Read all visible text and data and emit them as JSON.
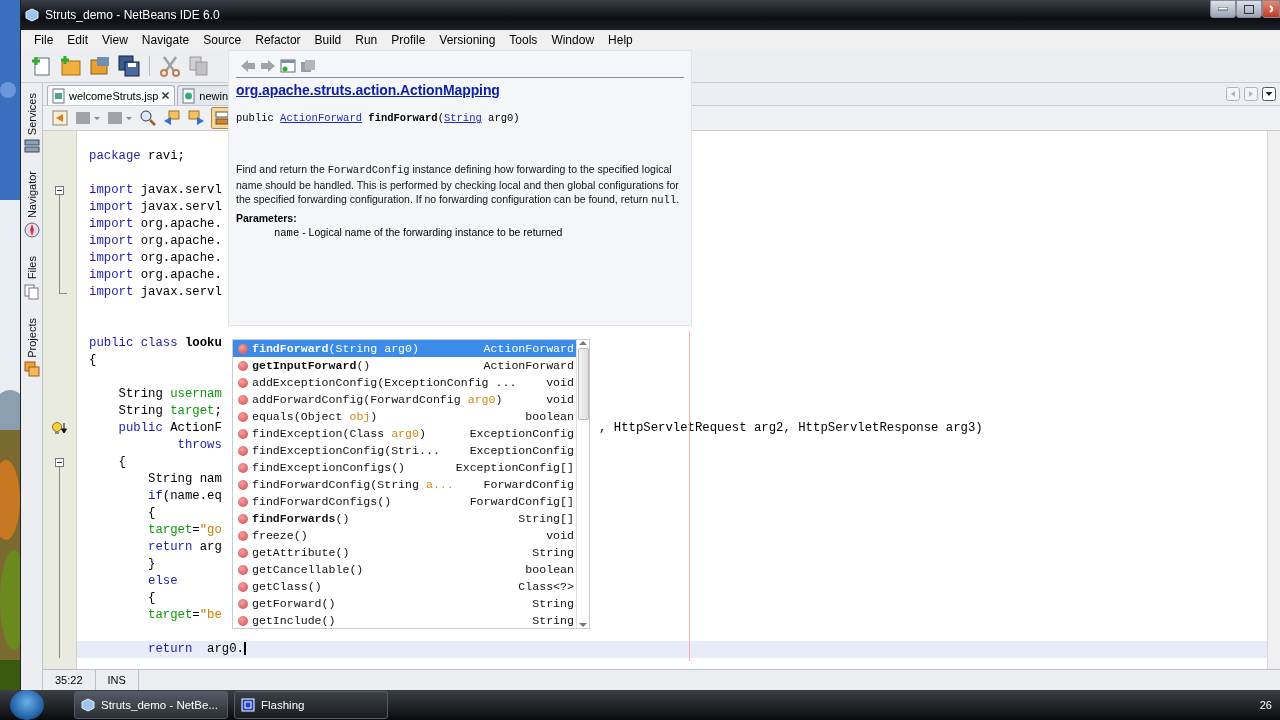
{
  "window": {
    "title": "Struts_demo - NetBeans IDE 6.0"
  },
  "menu": [
    "File",
    "Edit",
    "View",
    "Navigate",
    "Source",
    "Refactor",
    "Build",
    "Run",
    "Profile",
    "Versioning",
    "Tools",
    "Window",
    "Help"
  ],
  "side_tabs": [
    {
      "label": "Services",
      "kind": "services"
    },
    {
      "label": "Navigator",
      "kind": "navigator"
    },
    {
      "label": "Files",
      "kind": "files"
    },
    {
      "label": "Projects",
      "kind": "projects"
    }
  ],
  "editor_tabs": [
    {
      "label": "welcomeStruts.jsp",
      "selected": true,
      "kind": "jsp"
    },
    {
      "label": "newin",
      "selected": false,
      "kind": "html"
    }
  ],
  "code_lines": [
    {
      "kind": "plain",
      "tokens": [
        {
          "kind": "keyword",
          "text": "package"
        },
        {
          "kind": "plain",
          "text": " ravi;"
        }
      ]
    },
    {
      "kind": "blank"
    },
    {
      "kind": "fold-start",
      "tokens": [
        {
          "kind": "keyword",
          "text": "import"
        },
        {
          "kind": "plain",
          "text": " javax.servl"
        }
      ]
    },
    {
      "kind": "fold-line",
      "tokens": [
        {
          "kind": "keyword",
          "text": "import"
        },
        {
          "kind": "plain",
          "text": " javax.servl"
        }
      ]
    },
    {
      "kind": "fold-line",
      "tokens": [
        {
          "kind": "keyword",
          "text": "import"
        },
        {
          "kind": "plain",
          "text": " org.apache."
        }
      ]
    },
    {
      "kind": "fold-line",
      "tokens": [
        {
          "kind": "keyword",
          "text": "import"
        },
        {
          "kind": "plain",
          "text": " org.apache."
        }
      ]
    },
    {
      "kind": "fold-line",
      "tokens": [
        {
          "kind": "keyword",
          "text": "import"
        },
        {
          "kind": "plain",
          "text": " org.apache."
        }
      ]
    },
    {
      "kind": "fold-line",
      "tokens": [
        {
          "kind": "keyword",
          "text": "import"
        },
        {
          "kind": "plain",
          "text": " org.apache."
        }
      ]
    },
    {
      "kind": "fold-end",
      "tokens": [
        {
          "kind": "keyword",
          "text": "import"
        },
        {
          "kind": "plain",
          "text": " javax.servl"
        }
      ]
    },
    {
      "kind": "blank"
    },
    {
      "kind": "blank"
    },
    {
      "kind": "plain",
      "tokens": [
        {
          "kind": "keyword",
          "text": "public class"
        },
        {
          "kind": "bold",
          "text": " looku"
        }
      ]
    },
    {
      "kind": "plain",
      "tokens": [
        {
          "kind": "plain",
          "text": "{"
        }
      ]
    },
    {
      "kind": "blank"
    },
    {
      "kind": "plain",
      "tokens": [
        {
          "kind": "plain",
          "text": "    String "
        },
        {
          "kind": "field",
          "text": "usernam"
        }
      ]
    },
    {
      "kind": "plain",
      "tokens": [
        {
          "kind": "plain",
          "text": "    String "
        },
        {
          "kind": "field",
          "text": "target"
        },
        {
          "kind": "plain",
          "text": ";"
        }
      ]
    },
    {
      "kind": "hint",
      "tokens": [
        {
          "kind": "keyword",
          "text": "    public"
        },
        {
          "kind": "plain",
          "text": " ActionF"
        }
      ],
      "tail": ", HttpServletRequest arg2, HttpServletResponse arg3)"
    },
    {
      "kind": "plain",
      "tokens": [
        {
          "kind": "keyword",
          "text": "            throws"
        }
      ]
    },
    {
      "kind": "fold-start",
      "tokens": [
        {
          "kind": "plain",
          "text": "    {"
        }
      ]
    },
    {
      "kind": "fold-line",
      "tokens": [
        {
          "kind": "plain",
          "text": "        String nam"
        }
      ]
    },
    {
      "kind": "fold-line",
      "tokens": [
        {
          "kind": "keyword",
          "text": "        if"
        },
        {
          "kind": "plain",
          "text": "(name.eq"
        }
      ]
    },
    {
      "kind": "fold-line",
      "tokens": [
        {
          "kind": "plain",
          "text": "        {"
        }
      ]
    },
    {
      "kind": "fold-line",
      "tokens": [
        {
          "kind": "field",
          "text": "        target"
        },
        {
          "kind": "plain",
          "text": "="
        },
        {
          "kind": "string",
          "text": "\"go"
        }
      ]
    },
    {
      "kind": "fold-line",
      "tokens": [
        {
          "kind": "keyword",
          "text": "        return"
        },
        {
          "kind": "plain",
          "text": " arg"
        }
      ]
    },
    {
      "kind": "fold-line",
      "tokens": [
        {
          "kind": "plain",
          "text": "        }"
        }
      ]
    },
    {
      "kind": "fold-line",
      "tokens": [
        {
          "kind": "keyword",
          "text": "        else"
        }
      ]
    },
    {
      "kind": "fold-line",
      "tokens": [
        {
          "kind": "plain",
          "text": "        {"
        }
      ]
    },
    {
      "kind": "fold-line",
      "tokens": [
        {
          "kind": "field",
          "text": "        target"
        },
        {
          "kind": "plain",
          "text": "="
        },
        {
          "kind": "string",
          "text": "\"be"
        }
      ]
    },
    {
      "kind": "fold-line"
    },
    {
      "kind": "fold-line",
      "current": true,
      "tokens": [
        {
          "kind": "keyword",
          "text": "        return"
        },
        {
          "kind": "plain",
          "text": "  arg0."
        }
      ]
    }
  ],
  "javadoc": {
    "class_link": "org.apache.struts.action.ActionMapping",
    "signature": [
      {
        "kind": "plain",
        "text": "public "
      },
      {
        "kind": "link",
        "text": "ActionForward"
      },
      {
        "kind": "bold",
        "text": " findForward"
      },
      {
        "kind": "plain",
        "text": "("
      },
      {
        "kind": "link",
        "text": "String"
      },
      {
        "kind": "plain",
        "text": " arg0)"
      }
    ],
    "description": [
      {
        "kind": "plain",
        "text": "Find and return the "
      },
      {
        "kind": "code",
        "text": "ForwardConfig"
      },
      {
        "kind": "plain",
        "text": " instance defining how forwarding to the specified logical name should be handled. This is performed by checking local and then global configurations for the specified forwarding configuration. If no forwarding configuration can be found, return "
      },
      {
        "kind": "code",
        "text": "null"
      },
      {
        "kind": "plain",
        "text": "."
      }
    ],
    "parameters_heading": "Parameters:",
    "parameters": [
      {
        "name": "name",
        "description": " - Logical name of the forwarding instance to be returned"
      }
    ]
  },
  "completion": [
    {
      "selected": true,
      "bold": true,
      "parts": [
        {
          "kind": "name",
          "text": "findForward"
        },
        {
          "kind": "plain",
          "text": "(String "
        },
        {
          "kind": "plain",
          "text": "arg0)"
        }
      ],
      "type": "ActionForward"
    },
    {
      "selected": false,
      "bold": true,
      "parts": [
        {
          "kind": "name",
          "text": "getInputForward"
        },
        {
          "kind": "plain",
          "text": "()"
        }
      ],
      "type": "ActionForward"
    },
    {
      "selected": false,
      "bold": false,
      "parts": [
        {
          "kind": "name",
          "text": "addExceptionConfig"
        },
        {
          "kind": "plain",
          "text": "(ExceptionConfig ..."
        }
      ],
      "type": "void"
    },
    {
      "selected": false,
      "bold": false,
      "parts": [
        {
          "kind": "name",
          "text": "addForwardConfig"
        },
        {
          "kind": "plain",
          "text": "(ForwardConfig "
        },
        {
          "kind": "arg",
          "text": "arg0"
        },
        {
          "kind": "plain",
          "text": ")"
        }
      ],
      "type": "void"
    },
    {
      "selected": false,
      "bold": false,
      "parts": [
        {
          "kind": "name",
          "text": "equals"
        },
        {
          "kind": "plain",
          "text": "(Object "
        },
        {
          "kind": "arg",
          "text": "obj"
        },
        {
          "kind": "plain",
          "text": ")"
        }
      ],
      "type": "boolean"
    },
    {
      "selected": false,
      "bold": false,
      "parts": [
        {
          "kind": "name",
          "text": "findException"
        },
        {
          "kind": "plain",
          "text": "(Class "
        },
        {
          "kind": "arg",
          "text": "arg0"
        },
        {
          "kind": "plain",
          "text": ")"
        }
      ],
      "type": "ExceptionConfig"
    },
    {
      "selected": false,
      "bold": false,
      "parts": [
        {
          "kind": "name",
          "text": "findExceptionConfig"
        },
        {
          "kind": "plain",
          "text": "(Stri..."
        }
      ],
      "type": "ExceptionConfig"
    },
    {
      "selected": false,
      "bold": false,
      "parts": [
        {
          "kind": "name",
          "text": "findExceptionConfigs"
        },
        {
          "kind": "plain",
          "text": "()"
        }
      ],
      "type": "ExceptionConfig[]"
    },
    {
      "selected": false,
      "bold": false,
      "parts": [
        {
          "kind": "name",
          "text": "findForwardConfig"
        },
        {
          "kind": "plain",
          "text": "(String "
        },
        {
          "kind": "arg",
          "text": "a..."
        }
      ],
      "type": "ForwardConfig"
    },
    {
      "selected": false,
      "bold": false,
      "parts": [
        {
          "kind": "name",
          "text": "findForwardConfigs"
        },
        {
          "kind": "plain",
          "text": "()"
        }
      ],
      "type": "ForwardConfig[]"
    },
    {
      "selected": false,
      "bold": true,
      "parts": [
        {
          "kind": "name",
          "text": "findForwards"
        },
        {
          "kind": "plain",
          "text": "()"
        }
      ],
      "type": "String[]"
    },
    {
      "selected": false,
      "bold": false,
      "parts": [
        {
          "kind": "name",
          "text": "freeze"
        },
        {
          "kind": "plain",
          "text": "()"
        }
      ],
      "type": "void"
    },
    {
      "selected": false,
      "bold": false,
      "parts": [
        {
          "kind": "name",
          "text": "getAttribute"
        },
        {
          "kind": "plain",
          "text": "()"
        }
      ],
      "type": "String"
    },
    {
      "selected": false,
      "bold": false,
      "parts": [
        {
          "kind": "name",
          "text": "getCancellable"
        },
        {
          "kind": "plain",
          "text": "()"
        }
      ],
      "type": "boolean"
    },
    {
      "selected": false,
      "bold": false,
      "parts": [
        {
          "kind": "name",
          "text": "getClass"
        },
        {
          "kind": "plain",
          "text": "()"
        }
      ],
      "type": "Class<?>"
    },
    {
      "selected": false,
      "bold": false,
      "parts": [
        {
          "kind": "name",
          "text": "getForward"
        },
        {
          "kind": "plain",
          "text": "()"
        }
      ],
      "type": "String"
    },
    {
      "selected": false,
      "bold": false,
      "parts": [
        {
          "kind": "name",
          "text": "getInclude"
        },
        {
          "kind": "plain",
          "text": "()"
        }
      ],
      "type": "String"
    }
  ],
  "status_bar": {
    "position": "35:22",
    "mode": "INS"
  },
  "taskbar": {
    "tasks": [
      {
        "label": "Struts_demo - NetBe...",
        "selected": true,
        "kind": "netbeans"
      },
      {
        "label": "Flashing",
        "selected": false,
        "kind": "window"
      }
    ],
    "clock": "26"
  }
}
